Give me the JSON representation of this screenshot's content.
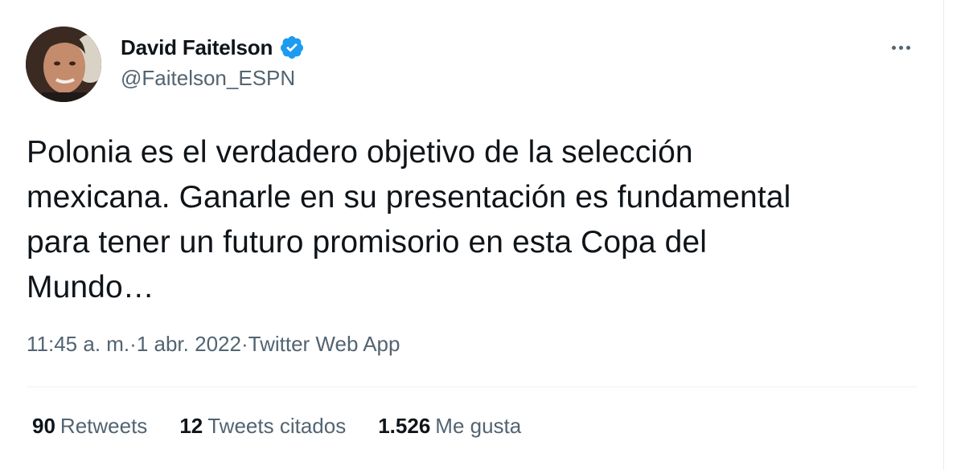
{
  "tweet": {
    "author_name": "David Faitelson",
    "handle": "@Faitelson_ESPN",
    "verified_icon": "verified-badge-icon",
    "more_icon": "more-options-icon",
    "text": "Polonia es el verdadero objetivo de la selección\nmexicana. Ganarle en su presentación es fundamental\npara tener un futuro promisorio en esta Copa del\nMundo…",
    "time": "11:45 a. m.",
    "separator": " · ",
    "date": "1 abr. 2022",
    "source": "Twitter Web App"
  },
  "stats": {
    "retweets_count": "90",
    "retweets_label": "Retweets",
    "quotes_count": "12",
    "quotes_label": "Tweets citados",
    "likes_count": "1.526",
    "likes_label": "Me gusta"
  },
  "colors": {
    "verified": "#1d9bf0",
    "secondary_text": "#536471",
    "primary_text": "#0f1419"
  }
}
